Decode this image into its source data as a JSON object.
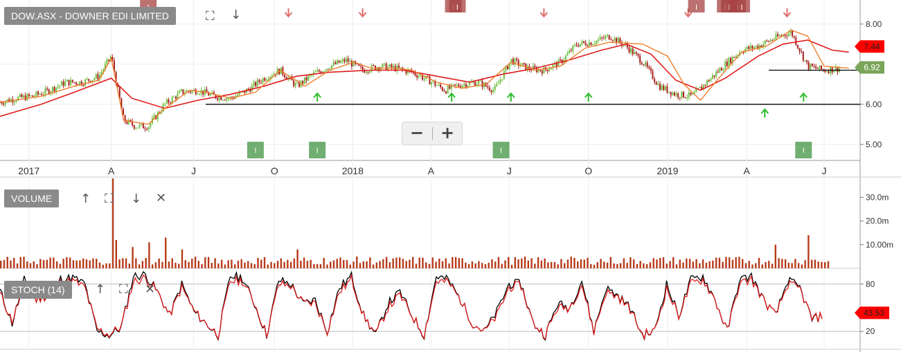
{
  "panels": {
    "price": {
      "title": "DOW.ASX - DOWNER EDI LIMITED"
    },
    "volume": {
      "title": "VOLUME"
    },
    "stoch": {
      "title": "STOCH (14)"
    }
  },
  "icons": {
    "expand": "expand-icon",
    "down": "arrow-down-icon",
    "up": "arrow-up-icon",
    "close": "close-icon"
  },
  "zoom": {
    "out": "−",
    "in": "+"
  },
  "colors": {
    "up_candle": "#6dbf3f",
    "down_candle": "#a81c1c",
    "ma_fast": "#f07d2a",
    "ma_slow": "#e01b1b",
    "volume_bar": "#b73a1a",
    "stoch_k": "#000000",
    "stoch_d": "#e01b1b",
    "signal_up": "#2ebc2e",
    "signal_down": "#e06c6c",
    "marker_red": "#a64040",
    "marker_green": "#4e9a4e",
    "price_tag_red": "#ff0000",
    "price_tag_green": "#7aa55a"
  },
  "chart_data": [
    {
      "type": "candlestick",
      "title": "DOW.ASX - DOWNER EDI LIMITED",
      "x_tick_labels": [
        "2017",
        "A",
        "J",
        "O",
        "2018",
        "A",
        "J",
        "O",
        "2019",
        "A",
        "J"
      ],
      "x_range": [
        "2017-01",
        "2019-06"
      ],
      "y_ticks": [
        "5.00",
        "6.00",
        "8.00"
      ],
      "ylim": [
        4.6,
        8.6
      ],
      "grid": true,
      "series": [
        {
          "name": "",
          "kind": "moving_average_fast",
          "points": [
            [
              0,
              6.05
            ],
            [
              0.05,
              6.2
            ],
            [
              0.09,
              6.45
            ],
            [
              0.12,
              6.6
            ],
            [
              0.135,
              7.15
            ],
            [
              0.15,
              5.6
            ],
            [
              0.18,
              5.5
            ],
            [
              0.2,
              5.9
            ],
            [
              0.23,
              6.35
            ],
            [
              0.25,
              6.3
            ],
            [
              0.28,
              6.15
            ],
            [
              0.31,
              6.3
            ],
            [
              0.34,
              6.85
            ],
            [
              0.37,
              6.45
            ],
            [
              0.4,
              6.85
            ],
            [
              0.43,
              7.05
            ],
            [
              0.45,
              6.9
            ],
            [
              0.48,
              6.9
            ],
            [
              0.5,
              6.85
            ],
            [
              0.53,
              6.55
            ],
            [
              0.56,
              6.4
            ],
            [
              0.59,
              6.5
            ],
            [
              0.62,
              7.05
            ],
            [
              0.65,
              6.85
            ],
            [
              0.68,
              6.95
            ],
            [
              0.71,
              7.4
            ],
            [
              0.74,
              7.55
            ],
            [
              0.78,
              7.5
            ],
            [
              0.81,
              7.2
            ],
            [
              0.83,
              6.5
            ],
            [
              0.85,
              6.1
            ],
            [
              0.87,
              6.6
            ],
            [
              0.9,
              7.3
            ],
            [
              0.93,
              7.45
            ],
            [
              0.96,
              7.85
            ],
            [
              0.98,
              7.7
            ],
            [
              1.0,
              6.95
            ],
            [
              1.03,
              6.9
            ]
          ]
        },
        {
          "name": "",
          "kind": "moving_average_slow",
          "points": [
            [
              0,
              5.7
            ],
            [
              0.05,
              6.0
            ],
            [
              0.09,
              6.3
            ],
            [
              0.135,
              6.65
            ],
            [
              0.16,
              6.15
            ],
            [
              0.2,
              5.9
            ],
            [
              0.24,
              6.1
            ],
            [
              0.28,
              6.25
            ],
            [
              0.32,
              6.45
            ],
            [
              0.36,
              6.7
            ],
            [
              0.4,
              6.8
            ],
            [
              0.45,
              6.85
            ],
            [
              0.49,
              6.85
            ],
            [
              0.53,
              6.7
            ],
            [
              0.57,
              6.55
            ],
            [
              0.61,
              6.75
            ],
            [
              0.65,
              6.9
            ],
            [
              0.69,
              7.1
            ],
            [
              0.73,
              7.35
            ],
            [
              0.76,
              7.5
            ],
            [
              0.79,
              7.25
            ],
            [
              0.82,
              6.6
            ],
            [
              0.85,
              6.35
            ],
            [
              0.88,
              6.65
            ],
            [
              0.92,
              7.2
            ],
            [
              0.95,
              7.5
            ],
            [
              0.98,
              7.6
            ],
            [
              1.01,
              7.35
            ],
            [
              1.03,
              7.3
            ]
          ]
        }
      ],
      "candles": [
        [
          0,
          6.05
        ],
        [
          0.02,
          6.15
        ],
        [
          0.04,
          6.2
        ],
        [
          0.06,
          6.35
        ],
        [
          0.08,
          6.55
        ],
        [
          0.1,
          6.55
        ],
        [
          0.12,
          6.7
        ],
        [
          0.135,
          7.2
        ],
        [
          0.15,
          5.6
        ],
        [
          0.165,
          5.45
        ],
        [
          0.18,
          5.45
        ],
        [
          0.2,
          6.0
        ],
        [
          0.22,
          6.3
        ],
        [
          0.24,
          6.35
        ],
        [
          0.26,
          6.2
        ],
        [
          0.28,
          6.15
        ],
        [
          0.3,
          6.35
        ],
        [
          0.32,
          6.65
        ],
        [
          0.34,
          6.85
        ],
        [
          0.36,
          6.45
        ],
        [
          0.38,
          6.75
        ],
        [
          0.4,
          6.95
        ],
        [
          0.42,
          7.1
        ],
        [
          0.44,
          6.85
        ],
        [
          0.46,
          6.95
        ],
        [
          0.48,
          6.9
        ],
        [
          0.5,
          6.8
        ],
        [
          0.52,
          6.6
        ],
        [
          0.54,
          6.35
        ],
        [
          0.56,
          6.5
        ],
        [
          0.58,
          6.55
        ],
        [
          0.6,
          6.35
        ],
        [
          0.62,
          7.1
        ],
        [
          0.64,
          6.9
        ],
        [
          0.66,
          6.85
        ],
        [
          0.68,
          7.05
        ],
        [
          0.7,
          7.5
        ],
        [
          0.72,
          7.55
        ],
        [
          0.74,
          7.7
        ],
        [
          0.76,
          7.45
        ],
        [
          0.78,
          7.05
        ],
        [
          0.8,
          6.45
        ],
        [
          0.82,
          6.25
        ],
        [
          0.84,
          6.2
        ],
        [
          0.86,
          6.6
        ],
        [
          0.88,
          7.0
        ],
        [
          0.9,
          7.35
        ],
        [
          0.92,
          7.45
        ],
        [
          0.94,
          7.65
        ],
        [
          0.96,
          7.8
        ],
        [
          0.98,
          6.95
        ],
        [
          1.0,
          6.85
        ],
        [
          1.02,
          6.9
        ]
      ],
      "horizontal_levels": [
        6.0,
        6.85
      ],
      "price_tags": [
        "7.44",
        "6.92"
      ],
      "marker_label": "I"
    },
    {
      "type": "bar",
      "title": "VOLUME",
      "y_ticks": [
        "10.00m",
        "20.0m",
        "30.0m"
      ],
      "ylim": [
        0,
        38
      ],
      "spikes": [
        [
          0.135,
          38
        ],
        [
          0.14,
          12
        ],
        [
          0.16,
          9
        ],
        [
          0.18,
          11
        ],
        [
          0.2,
          13
        ],
        [
          0.22,
          8
        ],
        [
          0.36,
          8
        ],
        [
          0.94,
          10
        ],
        [
          0.98,
          14
        ]
      ]
    },
    {
      "type": "line",
      "title": "STOCH (14)",
      "y_ticks": [
        "20",
        "80"
      ],
      "ylim": [
        0,
        100
      ],
      "series": [
        {
          "name": "",
          "kind": "k",
          "values": [
            72,
            30,
            85,
            60,
            70,
            86,
            88,
            80,
            20,
            15,
            25,
            90,
            92,
            70,
            40,
            80,
            45,
            30,
            15,
            90,
            88,
            55,
            15,
            85,
            80,
            55,
            60,
            20,
            75,
            90,
            40,
            15,
            55,
            70,
            40,
            15,
            90,
            85,
            60,
            30,
            20,
            45,
            80,
            80,
            30,
            15,
            55,
            50,
            85,
            20,
            75,
            65,
            50,
            15,
            20,
            80,
            40,
            85,
            90,
            60,
            20,
            85,
            90,
            60,
            40,
            85,
            75,
            35,
            40
          ]
        },
        {
          "name": "",
          "kind": "d",
          "values": [
            70,
            35,
            80,
            62,
            68,
            84,
            86,
            78,
            25,
            18,
            28,
            85,
            90,
            72,
            42,
            78,
            48,
            32,
            18,
            86,
            86,
            58,
            18,
            82,
            80,
            58,
            58,
            22,
            72,
            88,
            42,
            18,
            52,
            68,
            42,
            18,
            86,
            84,
            62,
            32,
            22,
            42,
            78,
            80,
            32,
            18,
            52,
            52,
            82,
            22,
            72,
            66,
            50,
            18,
            22,
            76,
            42,
            82,
            88,
            62,
            22,
            82,
            88,
            62,
            42,
            82,
            76,
            38,
            42
          ]
        }
      ],
      "price_tag": "43.53"
    }
  ]
}
